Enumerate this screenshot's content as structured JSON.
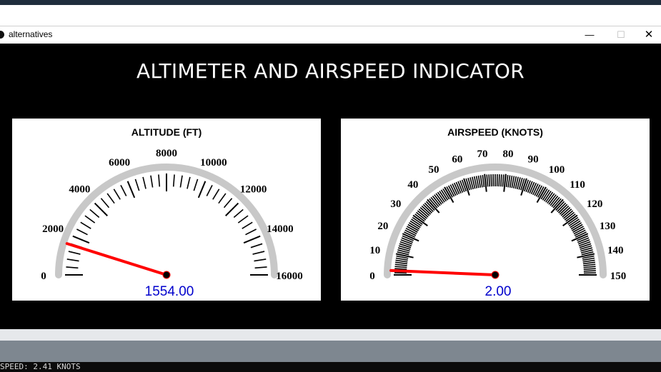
{
  "window": {
    "title": "alternatives",
    "minimize_label": "—",
    "maximize_label": "☐",
    "close_label": "✕"
  },
  "page_title": "ALTIMETER AND AIRSPEED INDICATOR",
  "altimeter": {
    "title": "ALTITUDE (FT)",
    "readout": "1554.00",
    "value": 1554.0,
    "min": 0,
    "max": 16000,
    "labels": [
      "0",
      "2000",
      "4000",
      "6000",
      "8000",
      "10000",
      "12000",
      "14000",
      "16000"
    ],
    "minor_ticks_per_major": 5,
    "needle_color": "#ff0000",
    "readout_color": "#0000cc"
  },
  "airspeed": {
    "title": "AIRSPEED (KNOTS)",
    "readout": "2.00",
    "value": 2.0,
    "min": 0,
    "max": 150,
    "labels": [
      "0",
      "10",
      "20",
      "30",
      "40",
      "50",
      "60",
      "70",
      "80",
      "90",
      "100",
      "110",
      "120",
      "130",
      "140",
      "150"
    ],
    "minor_ticks_per_major": 10,
    "needle_color": "#ff0000",
    "readout_color": "#0000cc"
  },
  "console": {
    "text": "SPEED: 2.41 KNOTS"
  }
}
